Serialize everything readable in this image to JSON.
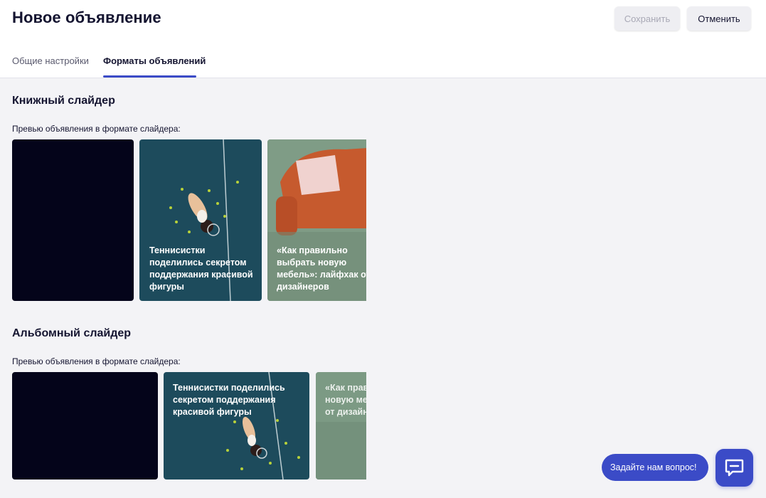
{
  "header": {
    "title": "Новое объявление",
    "save_label": "Сохранить",
    "cancel_label": "Отменить"
  },
  "tabs": [
    {
      "label": "Общие настройки",
      "active": false
    },
    {
      "label": "Форматы объявлений",
      "active": true
    }
  ],
  "sections": [
    {
      "title": "Книжный слайдер",
      "subtitle": "Превью объявления в формате слайдера:",
      "cards": [
        {
          "kind": "dark",
          "text": ""
        },
        {
          "kind": "tennis",
          "text": "Теннисистки поделились секретом поддержания красивой фигуры"
        },
        {
          "kind": "sofa",
          "text": "«Как правильно выбрать новую мебель»: лайфхак от дизайнеров"
        }
      ]
    },
    {
      "title": "Альбомный слайдер",
      "subtitle": "Превью объявления в формате слайдера:",
      "cards": [
        {
          "kind": "dark",
          "text": ""
        },
        {
          "kind": "tennis",
          "text": "Теннисистки поделились секретом поддержания красивой фигуры"
        },
        {
          "kind": "sofa",
          "text": "«Как правильно выбрать новую мебель»: лайфхак от дизайнеров"
        }
      ]
    }
  ],
  "chat": {
    "label": "Задайте нам вопрос!",
    "icon": "chat-icon"
  },
  "colors": {
    "accent": "#3b4bc7",
    "dark_card": "#04041a",
    "tennis_card": "#1d4b5c",
    "sofa_card": "#7f9c86"
  }
}
